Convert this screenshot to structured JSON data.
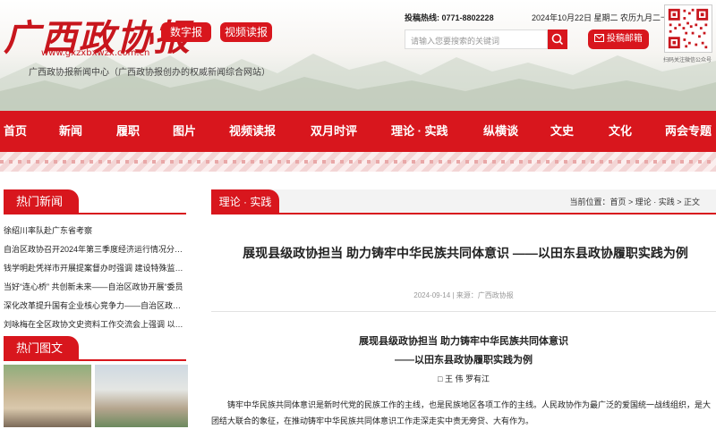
{
  "header": {
    "logo_text": "广西政协报",
    "logo_url": "www.gxzxbxwzx.com.cn",
    "subtitle": "广西政协报新闻中心（广西政协报创办的权威新闻综合网站）",
    "buttons": [
      "数字报",
      "视频读报"
    ],
    "hotline_label": "投稿热线:",
    "hotline_number": "0771-8802228",
    "date": "2024年10月22日 星期二 农历九月二十",
    "search_placeholder": "请输入您要搜索的关键词",
    "mailbox_label": "投稿邮箱",
    "qr_caption": "扫码关注微信公众号"
  },
  "nav": {
    "items": [
      "首页",
      "新闻",
      "履职",
      "图片",
      "视频读报",
      "双月时评",
      "理论 · 实践",
      "纵横谈",
      "文史",
      "文化",
      "两会专题"
    ]
  },
  "sidebar": {
    "hot_news_title": "热门新闻",
    "hot_news": [
      "徐绍川率队赴广东省考察",
      "自治区政协召开2024年第三季度经济运行情况分析会",
      "钱学明赴凭祥市开展提案督办时强调 建设特殊监管区",
      "当好“连心桥” 共创新未来——自治区政协开展“委员",
      "深化改革提升国有企业核心竞争力——自治区政协召开",
      "刘咏梅在全区政协文史资料工作交流会上强调 以高质量"
    ],
    "hot_photos_title": "热门图文"
  },
  "main": {
    "section_tab": "理论 · 实践",
    "breadcrumb": "当前位置：首页 > 理论 · 实践 > 正文",
    "title": "展现县级政协担当 助力铸牢中华民族共同体意识 ——以田东县政协履职实践为例",
    "meta": "2024-09-14 | 来源：广西政协报",
    "subtitle1": "展现县级政协担当 助力铸牢中华民族共同体意识",
    "subtitle2": "——以田东县政协履职实践为例",
    "author": "□ 王 伟 罗有江",
    "body": "铸牢中华民族共同体意识是新时代党的民族工作的主线，也是民族地区各项工作的主线。人民政协作为最广泛的爱国统一战线组织，是大团结大联合的象征，在推动铸牢中华民族共同体意识工作走深走实中责无旁贷、大有作为。"
  },
  "colors": {
    "brand_red": "#d8161d"
  }
}
